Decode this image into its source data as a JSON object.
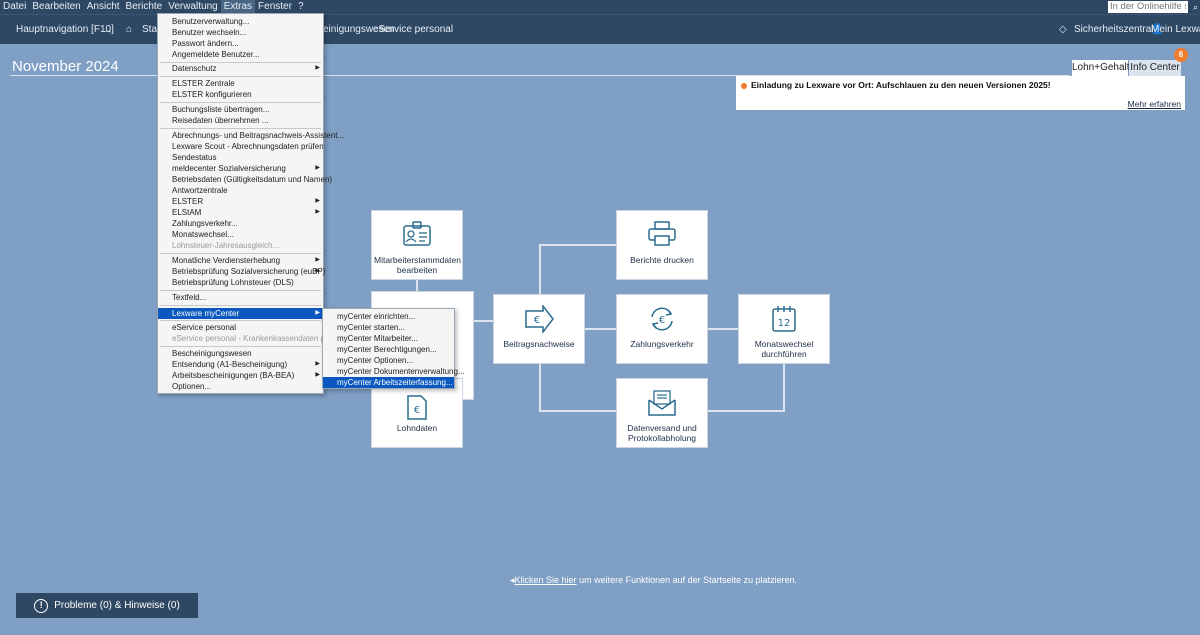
{
  "menubar": {
    "items": [
      "Datei",
      "Bearbeiten",
      "Ansicht",
      "Berichte",
      "Verwaltung",
      "Extras",
      "Fenster",
      "?"
    ],
    "search_placeholder": "In der Onlinehilfe suchen"
  },
  "navbar": {
    "main_nav": "Hauptnavigation [F10]",
    "start_truncated": "Starts",
    "mid_truncated": "einigungswesen",
    "eservice": "eService personal",
    "security": "Sicherheitszentrale",
    "account": "Mein Lexware"
  },
  "page": {
    "date_title": "November 2024",
    "tab_lohn": "Lohn+Gehalt",
    "tab_info": "Info Center",
    "info_badge": "6",
    "notice_text": "Einladung zu Lexware vor Ort: Aufschlauen zu den neuen Versionen 2025!",
    "notice_link": "Mehr erfahren"
  },
  "tiles": {
    "mitarbeiter": "Mitarbeiterstammdaten bearbeiten",
    "lohndaten": "Lohndaten",
    "beitrag": "Beitragsnachweise",
    "berichte": "Berichte drucken",
    "zahlung": "Zahlungsverkehr",
    "datenversand": "Datenversand und Protokollabholung",
    "monatswechsel": "Monatswechsel durchführen",
    "calendar_day": "12"
  },
  "hint": {
    "link": "Klicken Sie hier",
    "rest": " um weitere Funktionen auf der Startseite zu platzieren."
  },
  "problems_button": "Probleme (0) & Hinweise (0)",
  "extras_menu": [
    "Benutzerverwaltung...",
    "Benutzer wechseln...",
    "Passwort ändern...",
    "Angemeldete Benutzer...",
    "Datenschutz",
    "ELSTER Zentrale",
    "ELSTER konfigurieren",
    "Buchungsliste übertragen...",
    "Reisedaten übernehmen ...",
    "Abrechnungs- und Beitragsnachweis-Assistent...",
    "Lexware Scout - Abrechnungsdaten prüfen",
    "Sendestatus",
    "meldecenter Sozialversicherung",
    "Betriebsdaten (Gültigkeitsdatum und Namen)",
    "Antwortzentrale",
    "ELSTER",
    "ELStAM",
    "Zahlungsverkehr...",
    "Monatswechsel...",
    "Lohnsteuer-Jahresausgleich...",
    "Monatliche Verdiensterhebung",
    "Betriebsprüfung Sozialversicherung (euBP)",
    "Betriebsprüfung Lohnsteuer (DLS)",
    "Textfeld...",
    "Lexware myCenter",
    "eService personal",
    "eService personal - Krankenkassendaten prüfen",
    "Bescheinigungswesen",
    "Entsendung (A1-Bescheinigung)",
    "Arbeitsbescheinigungen (BA-BEA)",
    "Optionen..."
  ],
  "submenu": [
    "myCenter einrichten...",
    "myCenter starten...",
    "myCenter Mitarbeiter...",
    "myCenter Berechtigungen...",
    "myCenter Optionen...",
    "myCenter Dokumentenverwaltung...",
    "myCenter Arbeitszeiterfassung..."
  ],
  "colors": {
    "background": "#7f9fc4",
    "bar": "#2e4763",
    "highlight": "#0b58c0",
    "accent": "#f07d2d"
  }
}
